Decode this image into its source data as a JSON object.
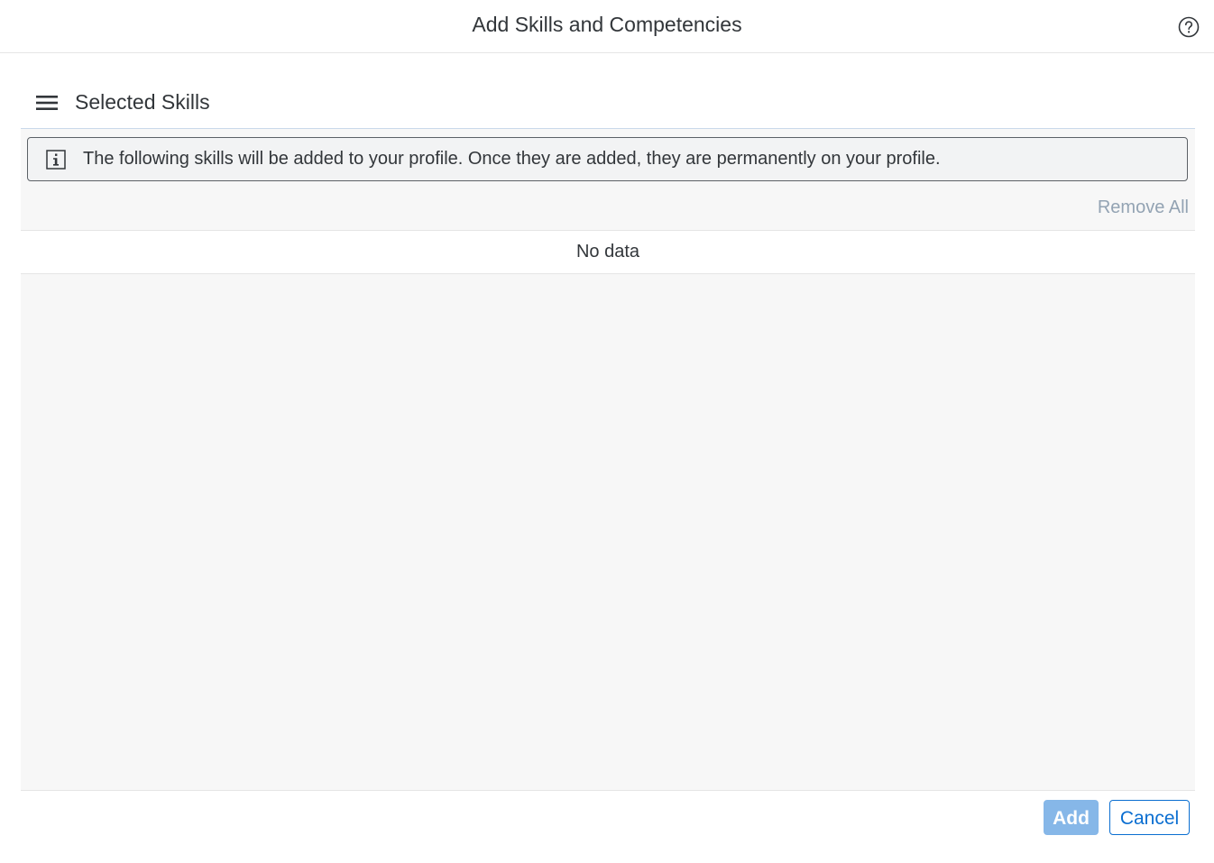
{
  "dialog": {
    "title": "Add Skills and Competencies"
  },
  "section": {
    "title": "Selected Skills"
  },
  "info": {
    "message": "The following skills will be added to your profile. Once they are added, they are permanently on your profile."
  },
  "toolbar": {
    "remove_all_label": "Remove All"
  },
  "table": {
    "empty_text": "No data",
    "rows": []
  },
  "footer": {
    "add_label": "Add",
    "cancel_label": "Cancel"
  },
  "icons": {
    "help": "help-icon",
    "menu": "menu-icon",
    "info": "info-icon"
  },
  "colors": {
    "accent": "#0a6ed1",
    "primary_disabled": "#86b7e8",
    "remove_all_disabled": "#93a3b3",
    "section_border": "#c9d9ea",
    "text": "#32363a",
    "content_background": "#f7f7f7"
  }
}
